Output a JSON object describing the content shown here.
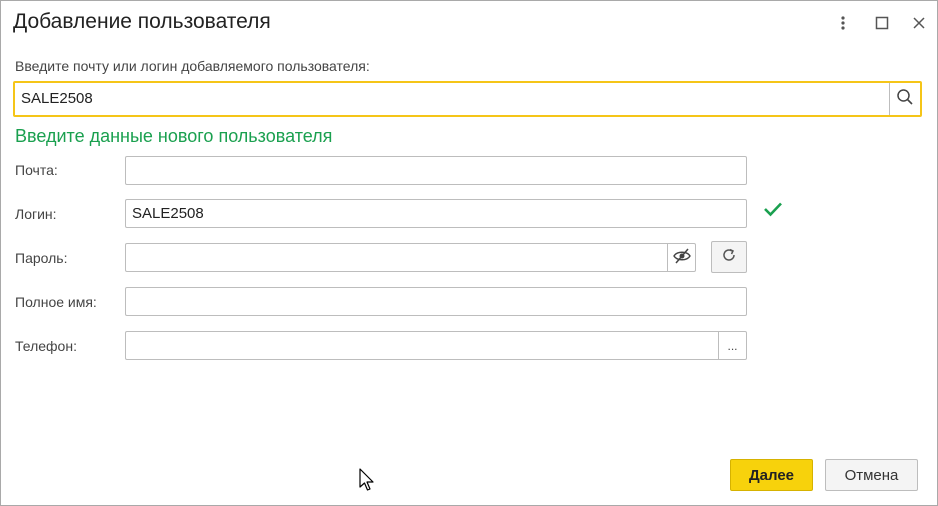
{
  "window": {
    "title": "Добавление пользователя"
  },
  "search": {
    "label": "Введите почту или логин добавляемого пользователя:",
    "value": "SALE2508"
  },
  "section_title": "Введите данные нового пользователя",
  "fields": {
    "email_label": "Почта:",
    "email_value": "",
    "login_label": "Логин:",
    "login_value": "SALE2508",
    "password_label": "Пароль:",
    "password_value": "",
    "fullname_label": "Полное имя:",
    "fullname_value": "",
    "phone_label": "Телефон:",
    "phone_value": "",
    "phone_more": "..."
  },
  "buttons": {
    "next": "Далее",
    "cancel": "Отмена"
  },
  "colors": {
    "accent_yellow": "#f5c518",
    "button_yellow": "#f7d20c",
    "section_green": "#1aa04f",
    "check_green": "#1aa04f"
  }
}
